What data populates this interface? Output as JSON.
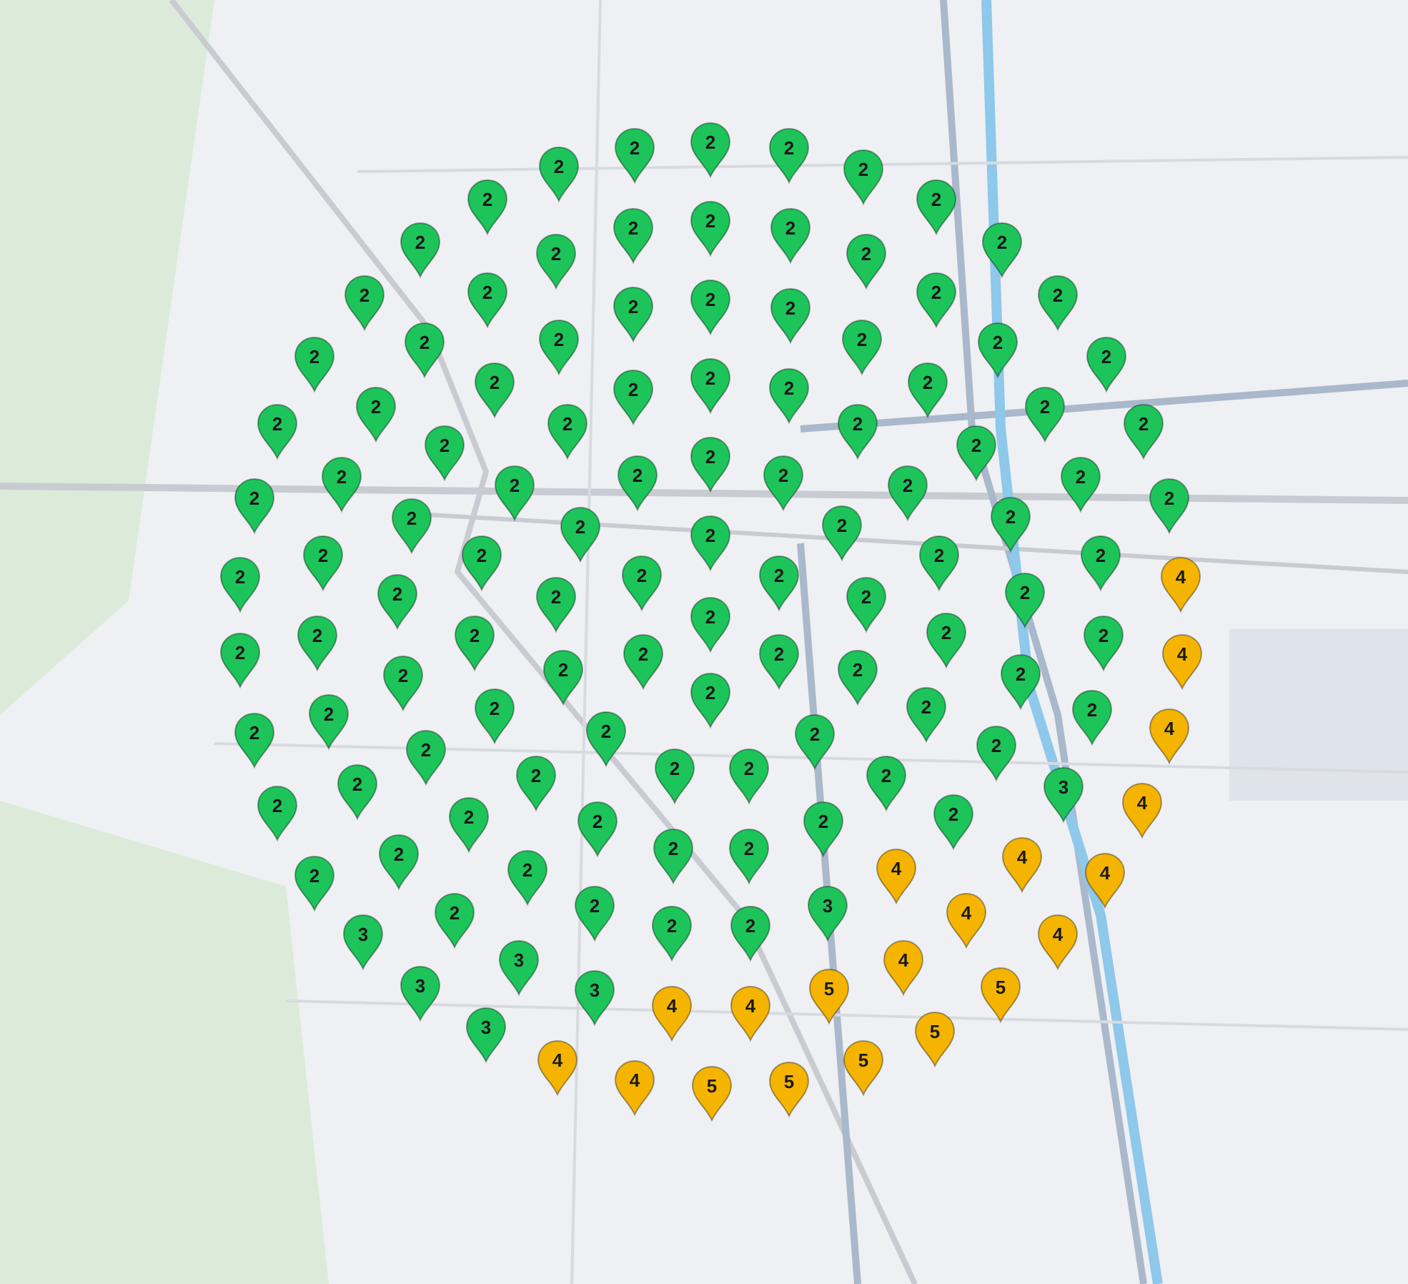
{
  "map": {
    "pins": [
      {
        "label": "2",
        "color": "#1dc45a"
      },
      {
        "label": "2",
        "color": "#1dc45a"
      },
      {
        "label": "2",
        "color": "#1dc45a"
      },
      {
        "label": "2",
        "color": "#1dc45a"
      },
      {
        "label": "2",
        "color": "#1dc45a"
      },
      {
        "label": "2",
        "color": "#1dc45a"
      },
      {
        "label": "2",
        "color": "#1dc45a"
      },
      {
        "label": "2",
        "color": "#1dc45a"
      },
      {
        "label": "2",
        "color": "#1dc45a"
      },
      {
        "label": "2",
        "color": "#1dc45a"
      },
      {
        "label": "2",
        "color": "#1dc45a"
      },
      {
        "label": "2",
        "color": "#1dc45a"
      },
      {
        "label": "2",
        "color": "#1dc45a"
      },
      {
        "label": "2",
        "color": "#1dc45a"
      },
      {
        "label": "2",
        "color": "#1dc45a"
      },
      {
        "label": "2",
        "color": "#1dc45a"
      },
      {
        "label": "2",
        "color": "#1dc45a"
      },
      {
        "label": "2",
        "color": "#1dc45a"
      },
      {
        "label": "2",
        "color": "#1dc45a"
      },
      {
        "label": "2",
        "color": "#1dc45a"
      },
      {
        "label": "2",
        "color": "#1dc45a"
      },
      {
        "label": "2",
        "color": "#1dc45a"
      },
      {
        "label": "2",
        "color": "#1dc45a"
      },
      {
        "label": "2",
        "color": "#1dc45a"
      },
      {
        "label": "2",
        "color": "#1dc45a"
      },
      {
        "label": "2",
        "color": "#1dc45a"
      },
      {
        "label": "2",
        "color": "#1dc45a"
      },
      {
        "label": "2",
        "color": "#1dc45a"
      },
      {
        "label": "2",
        "color": "#1dc45a"
      },
      {
        "label": "2",
        "color": "#1dc45a"
      },
      {
        "label": "2",
        "color": "#1dc45a"
      },
      {
        "label": "2",
        "color": "#1dc45a"
      },
      {
        "label": "2",
        "color": "#1dc45a"
      },
      {
        "label": "2",
        "color": "#1dc45a"
      },
      {
        "label": "2",
        "color": "#1dc45a"
      },
      {
        "label": "2",
        "color": "#1dc45a"
      },
      {
        "label": "2",
        "color": "#1dc45a"
      },
      {
        "label": "2",
        "color": "#1dc45a"
      },
      {
        "label": "2",
        "color": "#1dc45a"
      },
      {
        "label": "2",
        "color": "#1dc45a"
      },
      {
        "label": "2",
        "color": "#1dc45a"
      },
      {
        "label": "2",
        "color": "#1dc45a"
      },
      {
        "label": "2",
        "color": "#1dc45a"
      },
      {
        "label": "2",
        "color": "#1dc45a"
      },
      {
        "label": "2",
        "color": "#1dc45a"
      },
      {
        "label": "2",
        "color": "#1dc45a"
      },
      {
        "label": "2",
        "color": "#1dc45a"
      },
      {
        "label": "2",
        "color": "#1dc45a"
      },
      {
        "label": "2",
        "color": "#1dc45a"
      },
      {
        "label": "2",
        "color": "#1dc45a"
      },
      {
        "label": "2",
        "color": "#1dc45a"
      },
      {
        "label": "2",
        "color": "#1dc45a"
      },
      {
        "label": "2",
        "color": "#1dc45a"
      },
      {
        "label": "2",
        "color": "#1dc45a"
      },
      {
        "label": "2",
        "color": "#1dc45a"
      },
      {
        "label": "2",
        "color": "#1dc45a"
      },
      {
        "label": "2",
        "color": "#1dc45a"
      },
      {
        "label": "2",
        "color": "#1dc45a"
      },
      {
        "label": "2",
        "color": "#1dc45a"
      },
      {
        "label": "2",
        "color": "#1dc45a"
      },
      {
        "label": "2",
        "color": "#1dc45a"
      },
      {
        "label": "4",
        "color": "#f4b400"
      },
      {
        "label": "2",
        "color": "#1dc45a"
      },
      {
        "label": "2",
        "color": "#1dc45a"
      },
      {
        "label": "2",
        "color": "#1dc45a"
      },
      {
        "label": "2",
        "color": "#1dc45a"
      },
      {
        "label": "2",
        "color": "#1dc45a"
      },
      {
        "label": "2",
        "color": "#1dc45a"
      },
      {
        "label": "2",
        "color": "#1dc45a"
      },
      {
        "label": "2",
        "color": "#1dc45a"
      },
      {
        "label": "2",
        "color": "#1dc45a"
      },
      {
        "label": "2",
        "color": "#1dc45a"
      },
      {
        "label": "2",
        "color": "#1dc45a"
      },
      {
        "label": "2",
        "color": "#1dc45a"
      },
      {
        "label": "4",
        "color": "#f4b400"
      },
      {
        "label": "2",
        "color": "#1dc45a"
      },
      {
        "label": "2",
        "color": "#1dc45a"
      },
      {
        "label": "2",
        "color": "#1dc45a"
      },
      {
        "label": "2",
        "color": "#1dc45a"
      },
      {
        "label": "2",
        "color": "#1dc45a"
      },
      {
        "label": "2",
        "color": "#1dc45a"
      },
      {
        "label": "2",
        "color": "#1dc45a"
      },
      {
        "label": "2",
        "color": "#1dc45a"
      },
      {
        "label": "2",
        "color": "#1dc45a"
      },
      {
        "label": "2",
        "color": "#1dc45a"
      },
      {
        "label": "2",
        "color": "#1dc45a"
      },
      {
        "label": "2",
        "color": "#1dc45a"
      },
      {
        "label": "4",
        "color": "#f4b400"
      },
      {
        "label": "2",
        "color": "#1dc45a"
      },
      {
        "label": "2",
        "color": "#1dc45a"
      },
      {
        "label": "2",
        "color": "#1dc45a"
      },
      {
        "label": "2",
        "color": "#1dc45a"
      },
      {
        "label": "2",
        "color": "#1dc45a"
      },
      {
        "label": "2",
        "color": "#1dc45a"
      },
      {
        "label": "2",
        "color": "#1dc45a"
      },
      {
        "label": "3",
        "color": "#1dc45a"
      },
      {
        "label": "2",
        "color": "#1dc45a"
      },
      {
        "label": "4",
        "color": "#f4b400"
      },
      {
        "label": "2",
        "color": "#1dc45a"
      },
      {
        "label": "2",
        "color": "#1dc45a"
      },
      {
        "label": "2",
        "color": "#1dc45a"
      },
      {
        "label": "2",
        "color": "#1dc45a"
      },
      {
        "label": "2",
        "color": "#1dc45a"
      },
      {
        "label": "2",
        "color": "#1dc45a"
      },
      {
        "label": "2",
        "color": "#1dc45a"
      },
      {
        "label": "4",
        "color": "#f4b400"
      },
      {
        "label": "2",
        "color": "#1dc45a"
      },
      {
        "label": "2",
        "color": "#1dc45a"
      },
      {
        "label": "4",
        "color": "#f4b400"
      },
      {
        "label": "4",
        "color": "#f4b400"
      },
      {
        "label": "2",
        "color": "#1dc45a"
      },
      {
        "label": "2",
        "color": "#1dc45a"
      },
      {
        "label": "3",
        "color": "#1dc45a"
      },
      {
        "label": "4",
        "color": "#f4b400"
      },
      {
        "label": "3",
        "color": "#1dc45a"
      },
      {
        "label": "2",
        "color": "#1dc45a"
      },
      {
        "label": "2",
        "color": "#1dc45a"
      },
      {
        "label": "4",
        "color": "#f4b400"
      },
      {
        "label": "3",
        "color": "#1dc45a"
      },
      {
        "label": "4",
        "color": "#f4b400"
      },
      {
        "label": "3",
        "color": "#1dc45a"
      },
      {
        "label": "3",
        "color": "#1dc45a"
      },
      {
        "label": "5",
        "color": "#f4b400"
      },
      {
        "label": "5",
        "color": "#f4b400"
      },
      {
        "label": "4",
        "color": "#f4b400"
      },
      {
        "label": "4",
        "color": "#f4b400"
      },
      {
        "label": "3",
        "color": "#1dc45a"
      },
      {
        "label": "5",
        "color": "#f4b400"
      },
      {
        "label": "4",
        "color": "#f4b400"
      },
      {
        "label": "5",
        "color": "#f4b400"
      },
      {
        "label": "4",
        "color": "#f4b400"
      },
      {
        "label": "5",
        "color": "#f4b400"
      },
      {
        "label": "5",
        "color": "#f4b400"
      }
    ]
  }
}
